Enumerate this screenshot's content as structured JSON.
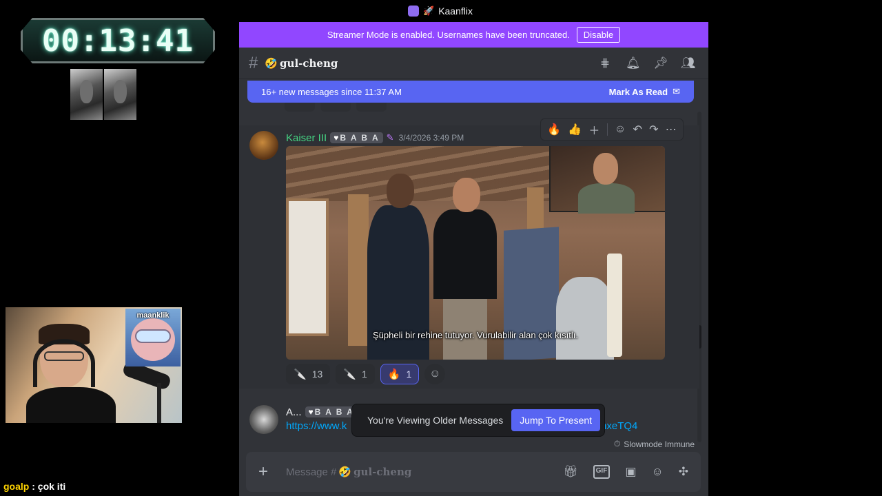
{
  "overlay": {
    "timer": "00:13:41",
    "sticker_label": "maanklik",
    "chat": {
      "user": "goalp",
      "separator": " : ",
      "text": "çok iti"
    }
  },
  "window": {
    "title": "Kaanflix"
  },
  "streamer_bar": {
    "text": "Streamer Mode is enabled. Usernames have been truncated.",
    "button": "Disable"
  },
  "channel": {
    "hash": "#",
    "emoji": "🤣",
    "name": "gul-cheng"
  },
  "header_icons": [
    "threads-icon",
    "bell-icon",
    "pin-icon",
    "members-icon"
  ],
  "new_messages": {
    "text": "16+ new messages since 11:37 AM",
    "action": "Mark As Read"
  },
  "message": {
    "author": "Kaiser III",
    "tag": "B A B A",
    "timestamp": "3/4/2026 3:49 PM",
    "video_subtitle": "Şüpheli bir rehine tutuyor. Vurulabilir alan çok kısıtlı.",
    "reactions": [
      {
        "icon": "🔪",
        "count": "13",
        "active": false
      },
      {
        "icon": "🔪",
        "count": "1",
        "active": false
      },
      {
        "icon": "🔥",
        "count": "1",
        "active": true
      }
    ]
  },
  "toolbar": {
    "emojis": [
      "🔥",
      "👍"
    ]
  },
  "message2": {
    "author": "A...",
    "tag": "B A B A",
    "link_start": "https://www.k",
    "link_end": "bbnhxeTQ4"
  },
  "older_toast": {
    "text": "You're Viewing Older Messages",
    "button": "Jump To Present"
  },
  "slowmode": "Slowmode Immune",
  "composer": {
    "placeholder_prefix": "Message #",
    "channel_emoji": "🤣",
    "channel_name": "gul-cheng",
    "gif_label": "GIF"
  },
  "colors": {
    "streamer_bar": "#9147ff",
    "blurple": "#5865f2",
    "author": "#45d483",
    "bg": "#313338"
  }
}
